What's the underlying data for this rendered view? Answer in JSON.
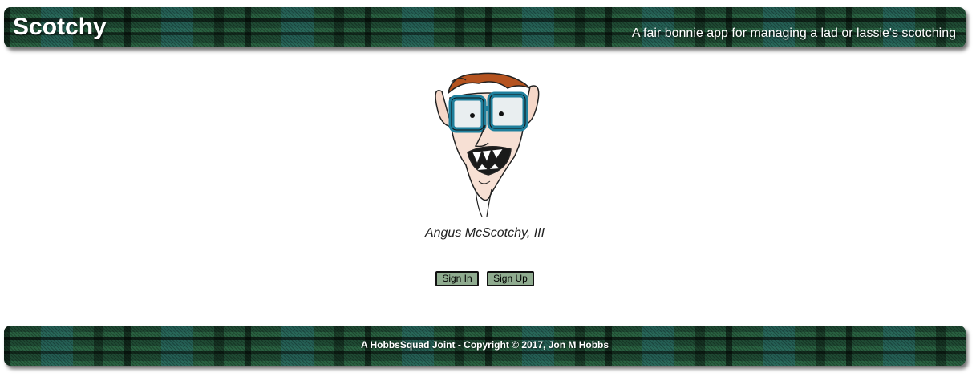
{
  "header": {
    "title": "Scotchy",
    "tagline": "A fair bonnie app for managing a lad or lassie's scotching"
  },
  "main": {
    "mascot_icon": "cartoon-face-glasses",
    "mascot_caption": "Angus McScotchy, III",
    "sign_in_label": "Sign In",
    "sign_up_label": "Sign Up"
  },
  "footer": {
    "copyright": "A HobbsSquad Joint - Copyright © 2017, Jon M Hobbs"
  },
  "colors": {
    "plaid_base": "#1f4a33",
    "plaid_teal": "#286e6e",
    "button_bg": "#8fab8f",
    "glasses": "#1f7f9c",
    "hair": "#b5531f"
  }
}
